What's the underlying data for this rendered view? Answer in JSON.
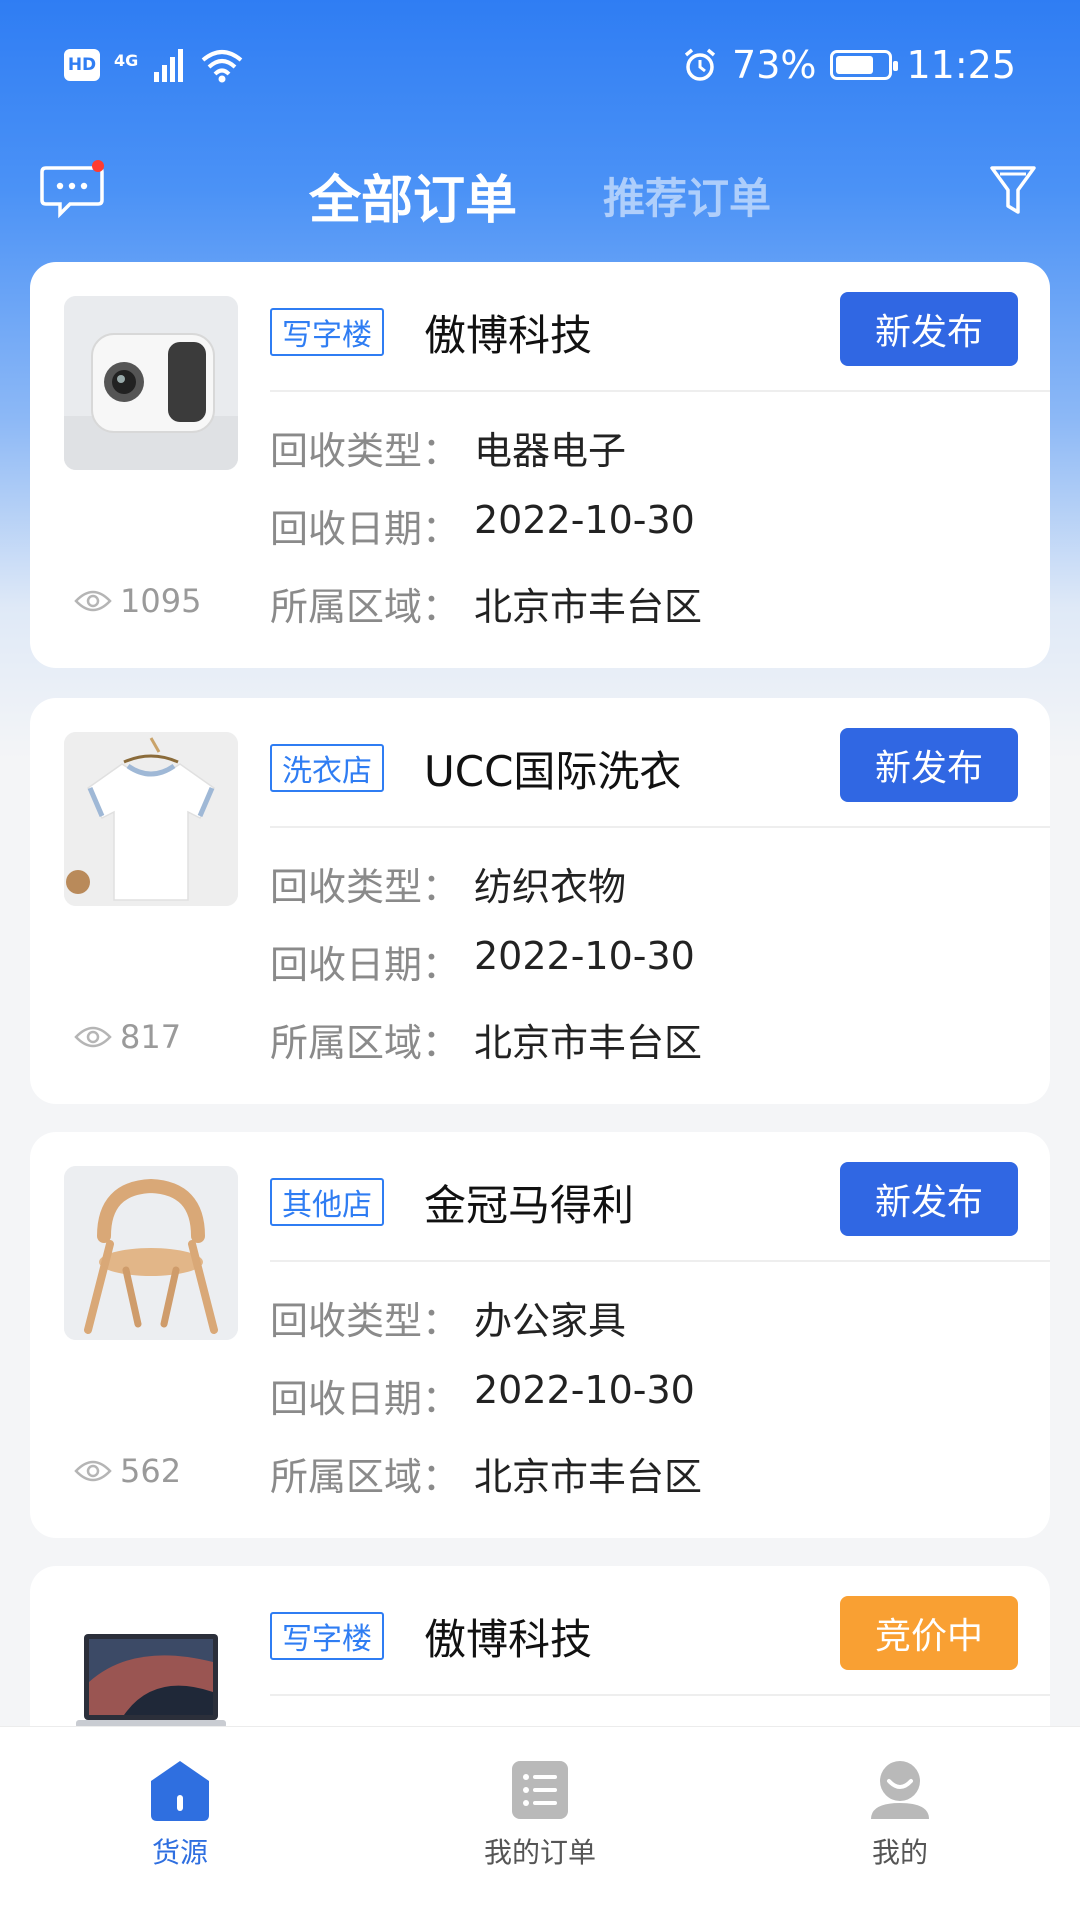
{
  "status_bar": {
    "hd": "HD",
    "network": "4G",
    "battery_text": "73%",
    "battery_level": 0.73,
    "time": "11:25"
  },
  "header": {
    "tab_all": "全部订单",
    "tab_recommended": "推荐订单"
  },
  "labels": {
    "type": "回收类型：",
    "date": "回收日期：",
    "area": "所属区域："
  },
  "orders": [
    {
      "tag": "写字楼",
      "company": "傲博科技",
      "status": "新发布",
      "type": "电器电子",
      "date": "2022-10-30",
      "area": "北京市丰台区",
      "views": "1095",
      "thumb": "projector"
    },
    {
      "tag": "洗衣店",
      "company": "UCC国际洗衣",
      "status": "新发布",
      "type": "纺织衣物",
      "date": "2022-10-30",
      "area": "北京市丰台区",
      "views": "817",
      "thumb": "tshirt"
    },
    {
      "tag": "其他店",
      "company": "金冠马得利",
      "status": "新发布",
      "type": "办公家具",
      "date": "2022-10-30",
      "area": "北京市丰台区",
      "views": "562",
      "thumb": "chair"
    },
    {
      "tag": "写字楼",
      "company": "傲博科技",
      "status": "竞价中",
      "thumb": "laptop"
    }
  ],
  "colors": {
    "primary": "#2f6fe0",
    "status_new": "#3067e3",
    "status_bidding": "#f9a033",
    "tag": "#2f7df3"
  },
  "bottom_nav": [
    {
      "label": "货源",
      "icon": "home-icon",
      "active": true
    },
    {
      "label": "我的订单",
      "icon": "list-icon",
      "active": false
    },
    {
      "label": "我的",
      "icon": "profile-icon",
      "active": false
    }
  ]
}
